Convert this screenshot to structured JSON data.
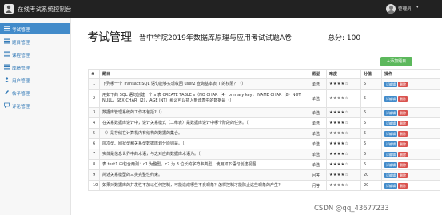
{
  "header": {
    "app_title": "在线考试系统控制台",
    "user_name": "管理员",
    "user_caret": "▾"
  },
  "sidebar": {
    "items": [
      {
        "label": "考试管理",
        "active": true
      },
      {
        "label": "题目管理"
      },
      {
        "label": "课程管理"
      },
      {
        "label": "成绩管理"
      },
      {
        "label": "用户管理"
      },
      {
        "label": "帖子管理"
      },
      {
        "label": "评论管理"
      }
    ]
  },
  "main": {
    "page_title": "考试管理",
    "exam_name": "晋中学院2019年数据库原理与应用考试试题A卷",
    "exam_score": "总分: 100",
    "add_button": "+添加题目"
  },
  "table": {
    "headers": [
      "#",
      "题目",
      "题型",
      "难度",
      "分值",
      "操作"
    ],
    "edit_label": "详编辑",
    "delete_label": "删除",
    "rows": [
      {
        "idx": "1",
        "question": "下列哪一个 Transact-SQL 语句能够实现收回 user2 查询基本表 T 的权限？（）",
        "type": "单选",
        "stars": "★★★★☆",
        "score": "5"
      },
      {
        "idx": "2",
        "question": "用如下的 SQL 语句创建一个 s 表 CREATE TABLE s（NO CHAR（4）primary key， NAME CHAR（8）NOT NULL，SEX CHAR（2），AGE INT）那么可以插入到该表中的数据是（）",
        "type": "单选",
        "stars": "★★★★☆",
        "score": "5"
      },
      {
        "idx": "3",
        "question": "数据库管理系统的工作不包括?（）",
        "type": "单选",
        "stars": "★★★★☆",
        "score": "5"
      },
      {
        "idx": "4",
        "question": "在关系数据库设计中，设计关系模式（二维表）是数据库设计中哪个阶段的任务。（）",
        "type": "单选",
        "stars": "★★★★☆",
        "score": "5"
      },
      {
        "idx": "5",
        "question": "（）是存储在计算机内有结构的数据的集合。",
        "type": "单选",
        "stars": "★★★★☆",
        "score": "5"
      },
      {
        "idx": "6",
        "question": "层次型、网状型和关系型数据库划分原则是。（）",
        "type": "单选",
        "stars": "★★★★☆",
        "score": "5"
      },
      {
        "idx": "7",
        "question": "实体是信息世界中的术语，与之对应的数据库术语为。（）",
        "type": "单选",
        "stars": "★★★★☆",
        "score": "5"
      },
      {
        "idx": "8",
        "question": "表 test1 中包含两列：c1 为整型，c2 为 8 位长的字符串类型，使用如下语句创建视图......",
        "type": "单选",
        "stars": "★★★★☆",
        "score": "5"
      },
      {
        "idx": "9",
        "question": "简述关系模型的三类完整性约束。",
        "type": "问答",
        "stars": "★★★★☆",
        "score": "20"
      },
      {
        "idx": "10",
        "question": "如果对数据库的并发性不加以任何控制，可能造成哪些不良现象？怎样控制才能防止这些现象的产生?",
        "type": "问答",
        "stars": "★★★★☆",
        "score": "20"
      }
    ]
  },
  "watermark": "CSDN @qq_43677233",
  "colors": {
    "topbar": "#222222",
    "active_nav": "#428bca",
    "add_button": "#5cb85c",
    "edit_button": "#428bca",
    "delete_button": "#d9534f"
  },
  "icons": {
    "logo": "person-logo-icon",
    "avatar": "user-avatar-icon",
    "nav": "list-icon"
  }
}
